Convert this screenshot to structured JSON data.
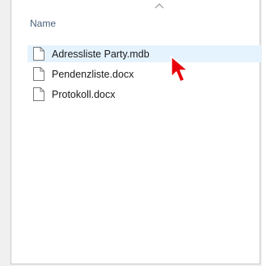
{
  "header": {
    "name_label": "Name"
  },
  "files": [
    {
      "name": "Adressliste Party.mdb",
      "selected": true
    },
    {
      "name": "Pendenzliste.docx",
      "selected": false
    },
    {
      "name": "Protokoll.docx",
      "selected": false
    }
  ],
  "icons": {
    "file": "document-icon",
    "sort": "chevron-up-icon",
    "cursor": "mouse-pointer-icon"
  },
  "colors": {
    "selection": "#e5f3ff",
    "cursor": "#e8000b",
    "header_text": "#4c607a"
  }
}
